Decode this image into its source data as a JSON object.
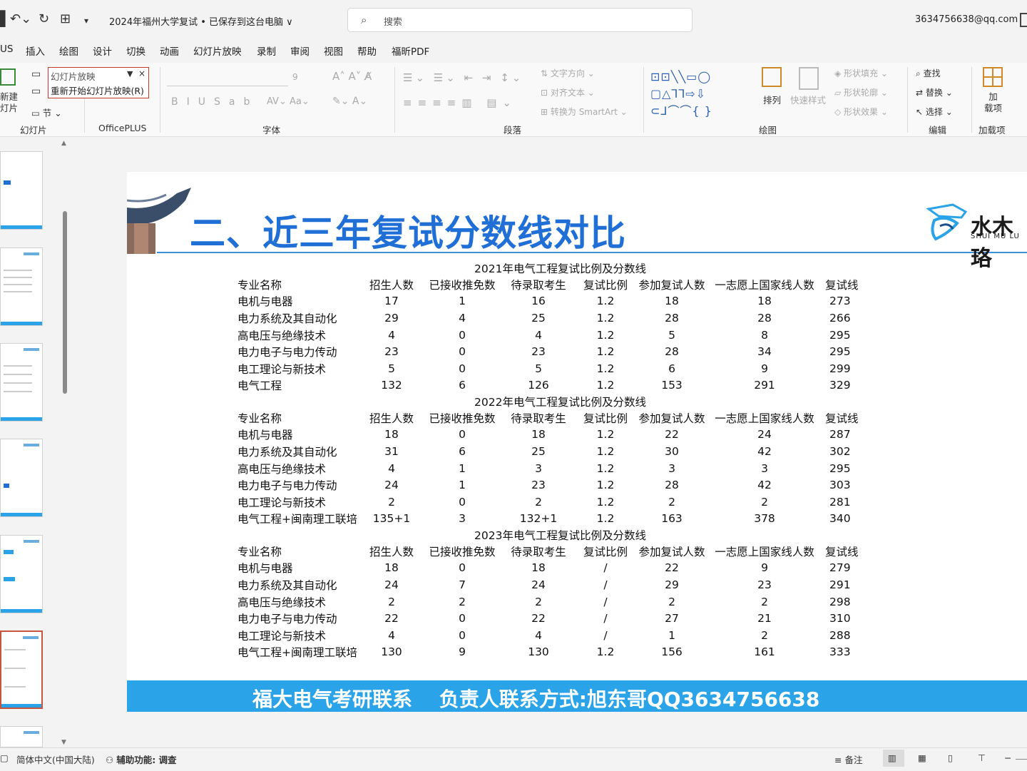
{
  "titlebar": {
    "doc_title": "2024年福州大学复试 • 已保存到这台电脑 ∨",
    "search_placeholder": "搜索",
    "account": "3634756638@qq.com"
  },
  "tabs": [
    "US",
    "插入",
    "绘图",
    "设计",
    "切换",
    "动画",
    "幻灯片放映",
    "录制",
    "审阅",
    "视图",
    "帮助",
    "福昕PDF"
  ],
  "ribbon": {
    "new_slide": "新建\n灯片",
    "section": "节",
    "group_slides": "幻灯片",
    "group_officeplus": "OfficePLUS",
    "group_font": "字体",
    "group_paragraph": "段落",
    "group_drawing": "绘图",
    "group_editing": "编辑",
    "group_addins": "加载项",
    "text_direction": "文字方向",
    "align_text": "对齐文本",
    "smartart": "转换为 SmartArt",
    "arrange": "排列",
    "quick_styles": "快速样式",
    "shape_fill": "形状填充",
    "shape_outline": "形状轮廓",
    "shape_effects": "形状效果",
    "find": "查找",
    "replace": "替换",
    "select": "选择",
    "addins": "加\n载项",
    "font_size": "9"
  },
  "dropdown": {
    "item1": "幻灯片放映",
    "item2": "重新开始幻灯片放映(R)"
  },
  "slide": {
    "title": "二、近三年复试分数线对比",
    "logo_text": "水木珞",
    "logo_sub": "SHUI MU LU",
    "footer": "福大电气考研联系　 负责人联系方式:旭东哥QQ3634756638"
  },
  "tables": [
    {
      "caption": "2021年电气工程复试比例及分数线",
      "headers": [
        "专业名称",
        "招生人数",
        "已接收推免数",
        "待录取考生",
        "复试比例",
        "参加复试人数",
        "一志愿上国家线人数",
        "复试线"
      ],
      "rows": [
        [
          "电机与电器",
          "17",
          "1",
          "16",
          "1.2",
          "18",
          "18",
          "273"
        ],
        [
          "电力系统及其自动化",
          "29",
          "4",
          "25",
          "1.2",
          "28",
          "28",
          "266"
        ],
        [
          "高电压与绝缘技术",
          "4",
          "0",
          "4",
          "1.2",
          "5",
          "8",
          "295"
        ],
        [
          "电力电子与电力传动",
          "23",
          "0",
          "23",
          "1.2",
          "28",
          "34",
          "295"
        ],
        [
          "电工理论与新技术",
          "5",
          "0",
          "5",
          "1.2",
          "6",
          "9",
          "299"
        ],
        [
          "电气工程",
          "132",
          "6",
          "126",
          "1.2",
          "153",
          "291",
          "329"
        ]
      ]
    },
    {
      "caption": "2022年电气工程复试比例及分数线",
      "headers": [
        "专业名称",
        "招生人数",
        "已接收推免数",
        "待录取考生",
        "复试比例",
        "参加复试人数",
        "一志愿上国家线人数",
        "复试线"
      ],
      "rows": [
        [
          "电机与电器",
          "18",
          "0",
          "18",
          "1.2",
          "22",
          "24",
          "287"
        ],
        [
          "电力系统及其自动化",
          "31",
          "6",
          "25",
          "1.2",
          "30",
          "42",
          "302"
        ],
        [
          "高电压与绝缘技术",
          "4",
          "1",
          "3",
          "1.2",
          "3",
          "3",
          "295"
        ],
        [
          "电力电子与电力传动",
          "24",
          "1",
          "23",
          "1.2",
          "28",
          "42",
          "303"
        ],
        [
          "电工理论与新技术",
          "2",
          "0",
          "2",
          "1.2",
          "2",
          "2",
          "281"
        ],
        [
          "电气工程+闽南理工联培",
          "135+1",
          "3",
          "132+1",
          "1.2",
          "163",
          "378",
          "340"
        ]
      ]
    },
    {
      "caption": "2023年电气工程复试比例及分数线",
      "headers": [
        "专业名称",
        "招生人数",
        "已接收推免数",
        "待录取考生",
        "复试比例",
        "参加复试人数",
        "一志愿上国家线人数",
        "复试线"
      ],
      "rows": [
        [
          "电机与电器",
          "18",
          "0",
          "18",
          "/",
          "22",
          "9",
          "279"
        ],
        [
          "电力系统及其自动化",
          "24",
          "7",
          "24",
          "/",
          "29",
          "23",
          "291"
        ],
        [
          "高电压与绝缘技术",
          "2",
          "2",
          "2",
          "/",
          "2",
          "2",
          "298"
        ],
        [
          "电力电子与电力传动",
          "22",
          "0",
          "22",
          "/",
          "27",
          "21",
          "310"
        ],
        [
          "电工理论与新技术",
          "4",
          "0",
          "4",
          "/",
          "1",
          "2",
          "288"
        ],
        [
          "电气工程+闽南理工联培",
          "130",
          "9",
          "130",
          "1.2",
          "156",
          "161",
          "333"
        ]
      ]
    }
  ],
  "statusbar": {
    "language": "简体中文(中国大陆)",
    "accessibility": "辅助功能: 调查",
    "notes": "备注"
  }
}
